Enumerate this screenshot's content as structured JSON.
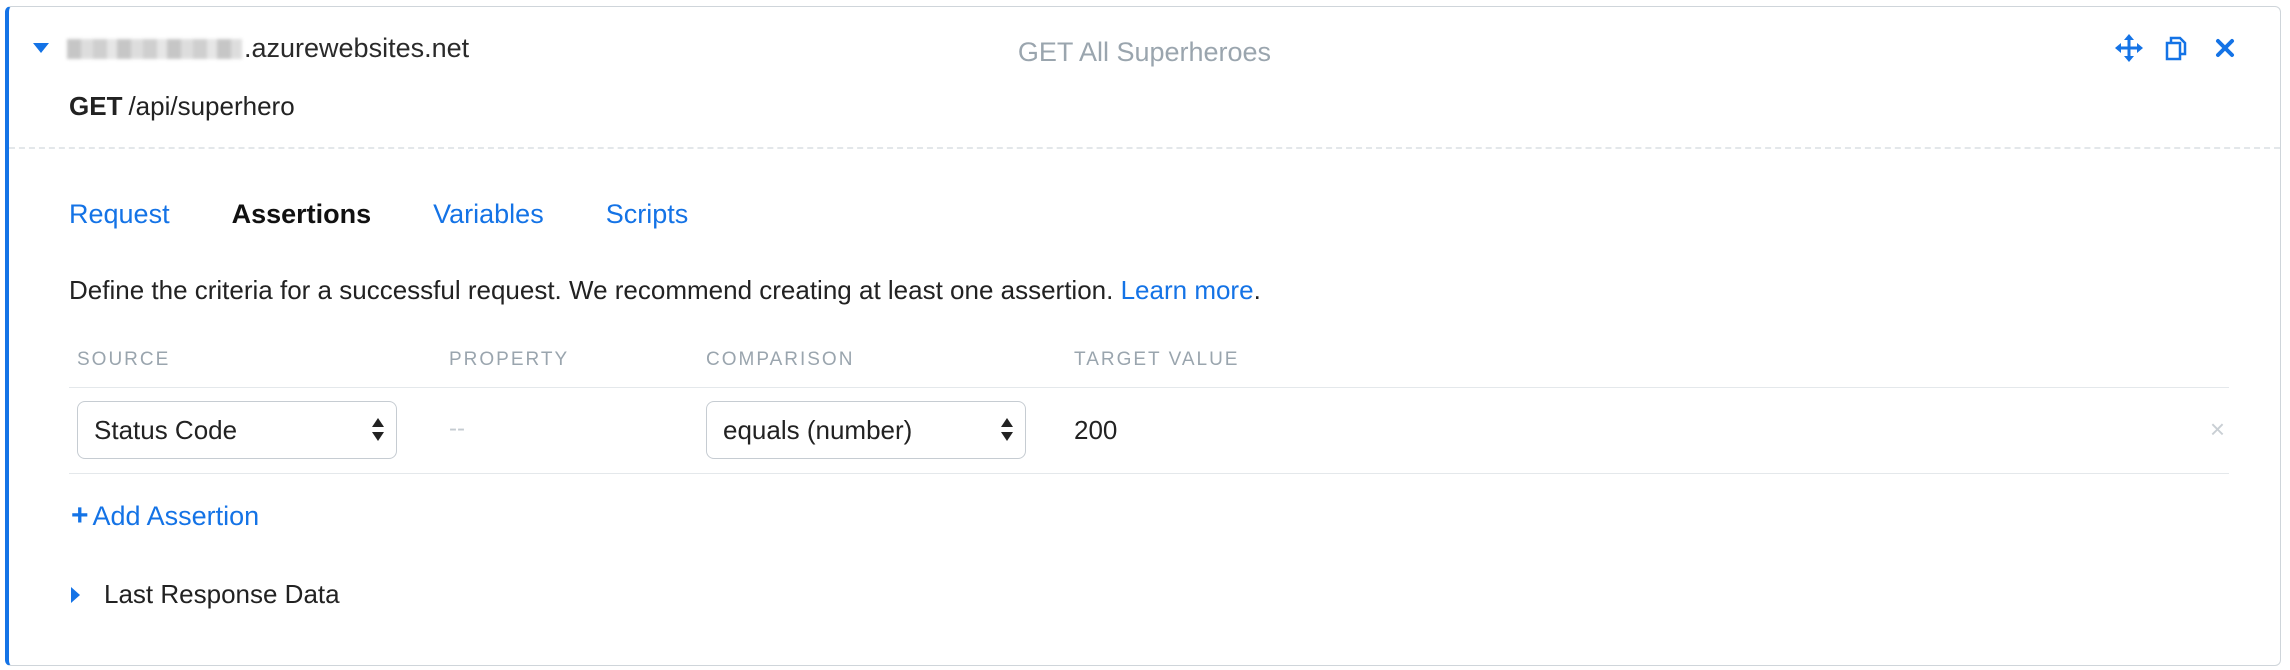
{
  "step": {
    "host_suffix": ".azurewebsites.net",
    "title": "GET All Superheroes",
    "method": "GET",
    "path": "/api/superhero",
    "actions": [
      {
        "icon": "move-icon"
      },
      {
        "icon": "duplicate-icon"
      },
      {
        "icon": "close-icon"
      }
    ]
  },
  "tabs": [
    {
      "label": "Request",
      "active": false
    },
    {
      "label": "Assertions",
      "active": true
    },
    {
      "label": "Variables",
      "active": false
    },
    {
      "label": "Scripts",
      "active": false
    }
  ],
  "assertions": {
    "description": "Define the criteria for a successful request. We recommend creating at least one assertion.",
    "learn_more": "Learn more",
    "headers": {
      "source": "SOURCE",
      "property": "PROPERTY",
      "comparison": "COMPARISON",
      "target_value": "TARGET VALUE"
    },
    "rows": [
      {
        "source": "Status Code",
        "property": "--",
        "comparison": "equals (number)",
        "target_value": "200",
        "remove_icon": "×"
      }
    ],
    "add_label": "Add Assertion",
    "add_icon": "+"
  },
  "last_response": {
    "label": "Last Response Data"
  },
  "colors": {
    "accent": "#1473e6",
    "muted": "#9aa5ae",
    "border": "#cfd5da"
  }
}
